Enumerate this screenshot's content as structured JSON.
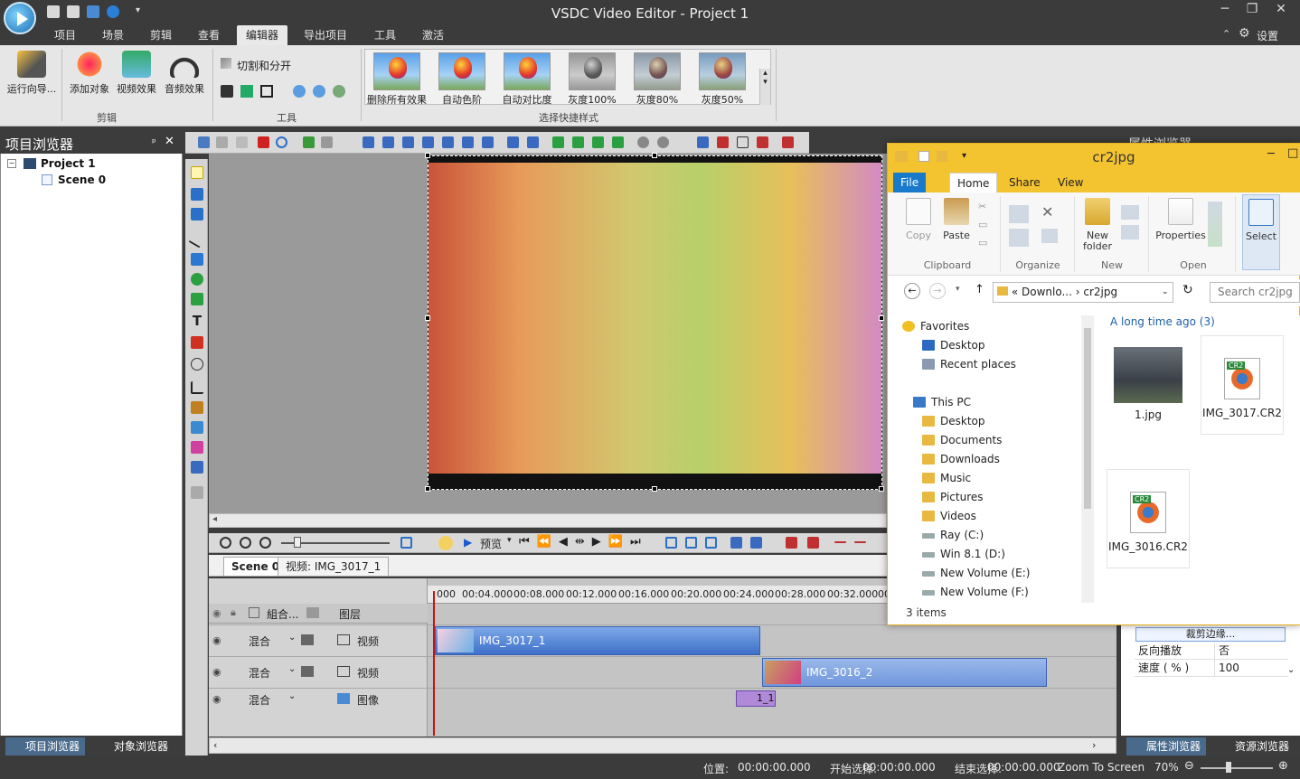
{
  "window": {
    "title": "VSDC Video Editor - Project 1",
    "settings_label": "设置"
  },
  "menu": {
    "tabs": [
      "项目",
      "场景",
      "剪辑",
      "查看",
      "编辑器",
      "导出项目",
      "工具",
      "激活"
    ],
    "active_index": 4
  },
  "ribbon": {
    "buttons": [
      "运行向导...",
      "添加对象",
      "视频效果",
      "音频效果"
    ],
    "tools_title": "切割和分开",
    "groups": {
      "edit": "剪辑",
      "tools": "工具",
      "styles": "选择快捷样式"
    },
    "styles": [
      "删除所有效果",
      "自动色阶",
      "自动对比度",
      "灰度100%",
      "灰度80%",
      "灰度50%"
    ]
  },
  "project_explorer": {
    "title": "项目浏览器",
    "tree": {
      "project": "Project 1",
      "scene": "Scene 0"
    },
    "tabs": [
      "项目浏览器",
      "对象浏览器"
    ]
  },
  "timeline": {
    "preview_label": "预览",
    "scene_tabs": [
      "Scene 0",
      "视频: IMG_3017_1"
    ],
    "header": {
      "combine": "組合...",
      "layer": "图层"
    },
    "ruler": [
      "000",
      "00:04.000",
      "00:08.000",
      "00:12.000",
      "00:16.000",
      "00:20.000",
      "00:24.000",
      "00:28.000",
      "00:32.000",
      "00"
    ],
    "tracks": [
      {
        "blend": "混合",
        "type": "视频",
        "clip": "IMG_3017_1"
      },
      {
        "blend": "混合",
        "type": "视频",
        "clip": "IMG_3016_2"
      },
      {
        "blend": "混合",
        "type": "图像",
        "clip": "1_1"
      }
    ]
  },
  "properties": {
    "title": "属性浏览器",
    "crop_button": "裁剪边缘...",
    "rows": [
      {
        "key": "反向播放",
        "value": "否"
      },
      {
        "key": "速度 ( % )",
        "value": "100"
      }
    ],
    "tabs": [
      "属性浏览器",
      "资源浏览器"
    ]
  },
  "statusbar": {
    "position_label": "位置:",
    "position_value": "00:00:00.000",
    "start_label": "开始选择:",
    "start_value": "00:00:00.000",
    "end_label": "结束选择:",
    "end_value": "00:00:00.000",
    "zoom_label": "Zoom To Screen",
    "zoom_value": "70%"
  },
  "explorer": {
    "title": "cr2jpg",
    "tabs": [
      "File",
      "Home",
      "Share",
      "View"
    ],
    "ribbon": {
      "copy": "Copy",
      "paste": "Paste",
      "new_folder_1": "New",
      "new_folder_2": "folder",
      "properties": "Properties",
      "select": "Select",
      "groups": [
        "Clipboard",
        "Organize",
        "New",
        "Open"
      ]
    },
    "address": {
      "prefix": "«",
      "part1": "Downlo...",
      "sep": "›",
      "part2": "cr2jpg",
      "search_placeholder": "Search cr2jpg"
    },
    "nav": [
      "Favorites",
      "Desktop",
      "Recent places",
      "This PC",
      "Desktop",
      "Documents",
      "Downloads",
      "Music",
      "Pictures",
      "Videos",
      "Ray (C:)",
      "Win 8.1 (D:)",
      "New Volume (E:)",
      "New Volume (F:)"
    ],
    "group_header": "A long time ago (3)",
    "files": [
      "1.jpg",
      "IMG_3017.CR2",
      "IMG_3016.CR2"
    ],
    "file_badge": "CR2",
    "status": "3 items"
  }
}
